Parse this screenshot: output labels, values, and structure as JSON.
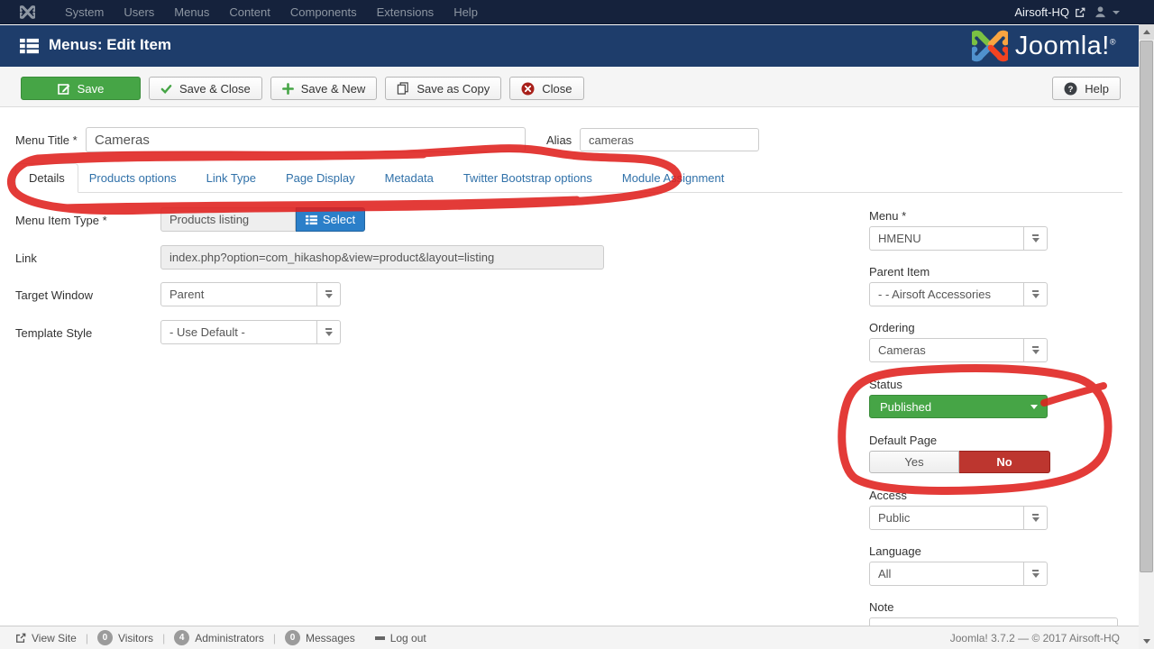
{
  "colors": {
    "topnav_bg": "#15223c",
    "header_bg": "#1e3d6b",
    "save_green": "#46a546",
    "select_blue": "#2b7fc9",
    "danger_red": "#bd362f",
    "link_blue": "#3071a9",
    "marker_red": "#e0201d"
  },
  "topnav": {
    "items": [
      "System",
      "Users",
      "Menus",
      "Content",
      "Components",
      "Extensions",
      "Help"
    ],
    "site_name": "Airsoft-HQ"
  },
  "header": {
    "title": "Menus: Edit Item",
    "brand": "Joomla!",
    "brand_mark": "®"
  },
  "toolbar": {
    "save": "Save",
    "save_close": "Save & Close",
    "save_new": "Save & New",
    "save_copy": "Save as Copy",
    "close": "Close",
    "help": "Help"
  },
  "form": {
    "menu_title": {
      "label": "Menu Title *",
      "value": "Cameras"
    },
    "alias": {
      "label": "Alias",
      "value": "cameras"
    },
    "tabs": [
      {
        "label": "Details",
        "active": true
      },
      {
        "label": "Products options",
        "active": false
      },
      {
        "label": "Link Type",
        "active": false
      },
      {
        "label": "Page Display",
        "active": false
      },
      {
        "label": "Metadata",
        "active": false
      },
      {
        "label": "Twitter Bootstrap options",
        "active": false
      },
      {
        "label": "Module Assignment",
        "active": false
      }
    ],
    "menu_item_type": {
      "label": "Menu Item Type *",
      "value": "Products listing",
      "button": "Select"
    },
    "link": {
      "label": "Link",
      "value": "index.php?option=com_hikashop&view=product&layout=listing"
    },
    "target_window": {
      "label": "Target Window",
      "value": "Parent"
    },
    "template_style": {
      "label": "Template Style",
      "value": "- Use Default -"
    },
    "menu": {
      "label": "Menu *",
      "value": "HMENU"
    },
    "parent_item": {
      "label": "Parent Item",
      "value": "- - Airsoft Accessories"
    },
    "ordering": {
      "label": "Ordering",
      "value": "Cameras"
    },
    "status": {
      "label": "Status",
      "value": "Published"
    },
    "default_page": {
      "label": "Default Page",
      "yes": "Yes",
      "no": "No",
      "selected": "No"
    },
    "access": {
      "label": "Access",
      "value": "Public"
    },
    "language": {
      "label": "Language",
      "value": "All"
    },
    "note": {
      "label": "Note",
      "value": ""
    }
  },
  "footer": {
    "view_site": "View Site",
    "visitors": {
      "count": "0",
      "label": "Visitors"
    },
    "administrators": {
      "count": "4",
      "label": "Administrators"
    },
    "messages": {
      "count": "0",
      "label": "Messages"
    },
    "logout": "Log out",
    "version_info": "Joomla! 3.7.2  —  © 2017 Airsoft-HQ"
  },
  "annotations": {
    "description": "hand-drawn red marker circle around tab bar and around Status / Default Page fields",
    "color": "#e0201d"
  }
}
